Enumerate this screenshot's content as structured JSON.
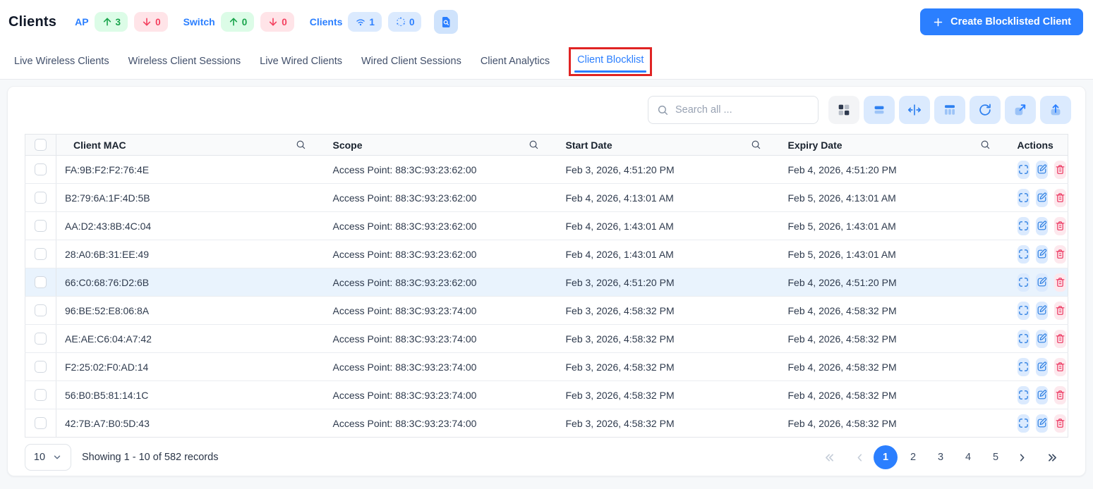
{
  "header": {
    "title": "Clients",
    "stats": {
      "ap": {
        "label": "AP",
        "up": "3",
        "down": "0"
      },
      "switch": {
        "label": "Switch",
        "up": "0",
        "down": "0"
      },
      "clients": {
        "label": "Clients",
        "wireless_count": "1",
        "mesh_count": "0"
      }
    },
    "create_button_label": "Create Blocklisted Client"
  },
  "tabs": {
    "items": [
      {
        "label": "Live Wireless Clients"
      },
      {
        "label": "Wireless Client Sessions"
      },
      {
        "label": "Live Wired Clients"
      },
      {
        "label": "Wired Client Sessions"
      },
      {
        "label": "Client Analytics"
      },
      {
        "label": "Client Blocklist"
      }
    ],
    "active_index": 5
  },
  "toolbar": {
    "search_placeholder": "Search all ...",
    "buttons": [
      "card-view",
      "row-density",
      "fit-columns",
      "table-columns",
      "refresh",
      "open-new",
      "export"
    ]
  },
  "table": {
    "columns": [
      "Client MAC",
      "Scope",
      "Start Date",
      "Expiry Date",
      "Actions"
    ],
    "row_actions": [
      "expand",
      "edit",
      "delete"
    ],
    "highlighted_row_index": 4,
    "rows": [
      {
        "mac": "FA:9B:F2:F2:76:4E",
        "scope": "Access Point: 88:3C:93:23:62:00",
        "start": "Feb 3, 2026, 4:51:20 PM",
        "expiry": "Feb 4, 2026, 4:51:20 PM"
      },
      {
        "mac": "B2:79:6A:1F:4D:5B",
        "scope": "Access Point: 88:3C:93:23:62:00",
        "start": "Feb 4, 2026, 4:13:01 AM",
        "expiry": "Feb 5, 2026, 4:13:01 AM"
      },
      {
        "mac": "AA:D2:43:8B:4C:04",
        "scope": "Access Point: 88:3C:93:23:62:00",
        "start": "Feb 4, 2026, 1:43:01 AM",
        "expiry": "Feb 5, 2026, 1:43:01 AM"
      },
      {
        "mac": "28:A0:6B:31:EE:49",
        "scope": "Access Point: 88:3C:93:23:62:00",
        "start": "Feb 4, 2026, 1:43:01 AM",
        "expiry": "Feb 5, 2026, 1:43:01 AM"
      },
      {
        "mac": "66:C0:68:76:D2:6B",
        "scope": "Access Point: 88:3C:93:23:62:00",
        "start": "Feb 3, 2026, 4:51:20 PM",
        "expiry": "Feb 4, 2026, 4:51:20 PM"
      },
      {
        "mac": "96:BE:52:E8:06:8A",
        "scope": "Access Point: 88:3C:93:23:74:00",
        "start": "Feb 3, 2026, 4:58:32 PM",
        "expiry": "Feb 4, 2026, 4:58:32 PM"
      },
      {
        "mac": "AE:AE:C6:04:A7:42",
        "scope": "Access Point: 88:3C:93:23:74:00",
        "start": "Feb 3, 2026, 4:58:32 PM",
        "expiry": "Feb 4, 2026, 4:58:32 PM"
      },
      {
        "mac": "F2:25:02:F0:AD:14",
        "scope": "Access Point: 88:3C:93:23:74:00",
        "start": "Feb 3, 2026, 4:58:32 PM",
        "expiry": "Feb 4, 2026, 4:58:32 PM"
      },
      {
        "mac": "56:B0:B5:81:14:1C",
        "scope": "Access Point: 88:3C:93:23:74:00",
        "start": "Feb 3, 2026, 4:58:32 PM",
        "expiry": "Feb 4, 2026, 4:58:32 PM"
      },
      {
        "mac": "42:7B:A7:B0:5D:43",
        "scope": "Access Point: 88:3C:93:23:74:00",
        "start": "Feb 3, 2026, 4:58:32 PM",
        "expiry": "Feb 4, 2026, 4:58:32 PM"
      }
    ]
  },
  "footer": {
    "page_size": "10",
    "showing_text": "Showing 1 - 10 of 582 records",
    "pagination": {
      "pages": [
        "1",
        "2",
        "3",
        "4",
        "5"
      ],
      "active_page": "1",
      "disabled_controls": [
        "first-page",
        "prev-page"
      ]
    }
  },
  "colors": {
    "primary": "#2b7fff",
    "green": "#17a34a",
    "green_badge_bg": "#dcfce7",
    "red": "#f43f5e",
    "red_badge_bg": "#ffe4e8",
    "blue_badge_bg": "#dbeafe",
    "highlighted_row_bg": "#e9f3fd",
    "annotation_box": "#e02424"
  }
}
